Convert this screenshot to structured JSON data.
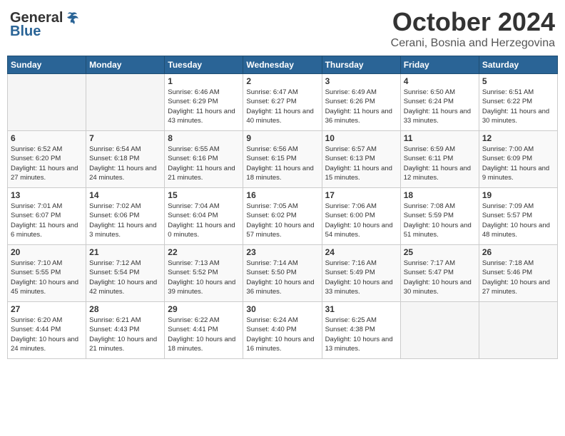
{
  "header": {
    "logo_general": "General",
    "logo_blue": "Blue",
    "month_title": "October 2024",
    "location": "Cerani, Bosnia and Herzegovina"
  },
  "weekdays": [
    "Sunday",
    "Monday",
    "Tuesday",
    "Wednesday",
    "Thursday",
    "Friday",
    "Saturday"
  ],
  "weeks": [
    [
      {
        "day": "",
        "info": ""
      },
      {
        "day": "",
        "info": ""
      },
      {
        "day": "1",
        "info": "Sunrise: 6:46 AM\nSunset: 6:29 PM\nDaylight: 11 hours and 43 minutes."
      },
      {
        "day": "2",
        "info": "Sunrise: 6:47 AM\nSunset: 6:27 PM\nDaylight: 11 hours and 40 minutes."
      },
      {
        "day": "3",
        "info": "Sunrise: 6:49 AM\nSunset: 6:26 PM\nDaylight: 11 hours and 36 minutes."
      },
      {
        "day": "4",
        "info": "Sunrise: 6:50 AM\nSunset: 6:24 PM\nDaylight: 11 hours and 33 minutes."
      },
      {
        "day": "5",
        "info": "Sunrise: 6:51 AM\nSunset: 6:22 PM\nDaylight: 11 hours and 30 minutes."
      }
    ],
    [
      {
        "day": "6",
        "info": "Sunrise: 6:52 AM\nSunset: 6:20 PM\nDaylight: 11 hours and 27 minutes."
      },
      {
        "day": "7",
        "info": "Sunrise: 6:54 AM\nSunset: 6:18 PM\nDaylight: 11 hours and 24 minutes."
      },
      {
        "day": "8",
        "info": "Sunrise: 6:55 AM\nSunset: 6:16 PM\nDaylight: 11 hours and 21 minutes."
      },
      {
        "day": "9",
        "info": "Sunrise: 6:56 AM\nSunset: 6:15 PM\nDaylight: 11 hours and 18 minutes."
      },
      {
        "day": "10",
        "info": "Sunrise: 6:57 AM\nSunset: 6:13 PM\nDaylight: 11 hours and 15 minutes."
      },
      {
        "day": "11",
        "info": "Sunrise: 6:59 AM\nSunset: 6:11 PM\nDaylight: 11 hours and 12 minutes."
      },
      {
        "day": "12",
        "info": "Sunrise: 7:00 AM\nSunset: 6:09 PM\nDaylight: 11 hours and 9 minutes."
      }
    ],
    [
      {
        "day": "13",
        "info": "Sunrise: 7:01 AM\nSunset: 6:07 PM\nDaylight: 11 hours and 6 minutes."
      },
      {
        "day": "14",
        "info": "Sunrise: 7:02 AM\nSunset: 6:06 PM\nDaylight: 11 hours and 3 minutes."
      },
      {
        "day": "15",
        "info": "Sunrise: 7:04 AM\nSunset: 6:04 PM\nDaylight: 11 hours and 0 minutes."
      },
      {
        "day": "16",
        "info": "Sunrise: 7:05 AM\nSunset: 6:02 PM\nDaylight: 10 hours and 57 minutes."
      },
      {
        "day": "17",
        "info": "Sunrise: 7:06 AM\nSunset: 6:00 PM\nDaylight: 10 hours and 54 minutes."
      },
      {
        "day": "18",
        "info": "Sunrise: 7:08 AM\nSunset: 5:59 PM\nDaylight: 10 hours and 51 minutes."
      },
      {
        "day": "19",
        "info": "Sunrise: 7:09 AM\nSunset: 5:57 PM\nDaylight: 10 hours and 48 minutes."
      }
    ],
    [
      {
        "day": "20",
        "info": "Sunrise: 7:10 AM\nSunset: 5:55 PM\nDaylight: 10 hours and 45 minutes."
      },
      {
        "day": "21",
        "info": "Sunrise: 7:12 AM\nSunset: 5:54 PM\nDaylight: 10 hours and 42 minutes."
      },
      {
        "day": "22",
        "info": "Sunrise: 7:13 AM\nSunset: 5:52 PM\nDaylight: 10 hours and 39 minutes."
      },
      {
        "day": "23",
        "info": "Sunrise: 7:14 AM\nSunset: 5:50 PM\nDaylight: 10 hours and 36 minutes."
      },
      {
        "day": "24",
        "info": "Sunrise: 7:16 AM\nSunset: 5:49 PM\nDaylight: 10 hours and 33 minutes."
      },
      {
        "day": "25",
        "info": "Sunrise: 7:17 AM\nSunset: 5:47 PM\nDaylight: 10 hours and 30 minutes."
      },
      {
        "day": "26",
        "info": "Sunrise: 7:18 AM\nSunset: 5:46 PM\nDaylight: 10 hours and 27 minutes."
      }
    ],
    [
      {
        "day": "27",
        "info": "Sunrise: 6:20 AM\nSunset: 4:44 PM\nDaylight: 10 hours and 24 minutes."
      },
      {
        "day": "28",
        "info": "Sunrise: 6:21 AM\nSunset: 4:43 PM\nDaylight: 10 hours and 21 minutes."
      },
      {
        "day": "29",
        "info": "Sunrise: 6:22 AM\nSunset: 4:41 PM\nDaylight: 10 hours and 18 minutes."
      },
      {
        "day": "30",
        "info": "Sunrise: 6:24 AM\nSunset: 4:40 PM\nDaylight: 10 hours and 16 minutes."
      },
      {
        "day": "31",
        "info": "Sunrise: 6:25 AM\nSunset: 4:38 PM\nDaylight: 10 hours and 13 minutes."
      },
      {
        "day": "",
        "info": ""
      },
      {
        "day": "",
        "info": ""
      }
    ]
  ]
}
